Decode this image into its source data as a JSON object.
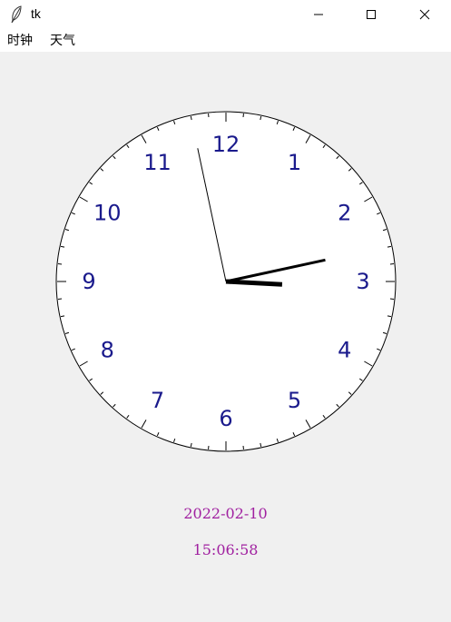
{
  "window": {
    "title": "tk",
    "icon": "feather-icon",
    "controls": {
      "minimize": "minimize-icon",
      "maximize": "maximize-icon",
      "close": "close-icon"
    }
  },
  "menu": {
    "items": [
      {
        "label": "时钟"
      },
      {
        "label": "天气"
      }
    ]
  },
  "clock": {
    "numerals": [
      "12",
      "1",
      "2",
      "3",
      "4",
      "5",
      "6",
      "7",
      "8",
      "9",
      "10",
      "11"
    ],
    "time": {
      "hour": 15,
      "minute": 6,
      "second": 58
    },
    "colors": {
      "face": "#ffffff",
      "rim": "#000000",
      "numerals": "#1a1a8c",
      "hands": "#000000"
    }
  },
  "display": {
    "date": "2022-02-10",
    "time": "15:06:58",
    "text_color": "#a020a0"
  }
}
